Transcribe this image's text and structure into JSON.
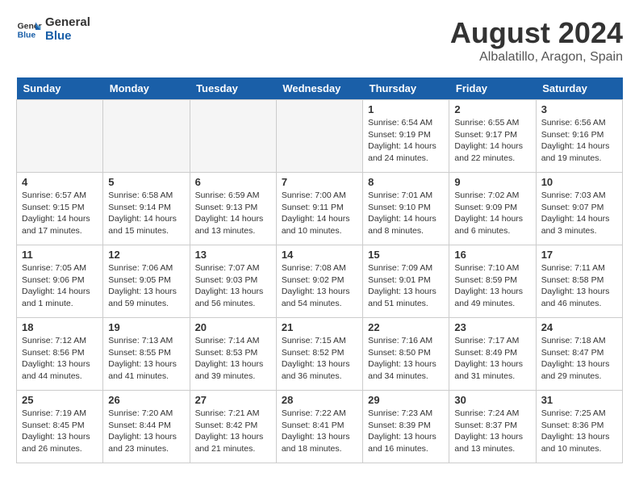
{
  "header": {
    "logo_line1": "General",
    "logo_line2": "Blue",
    "month_year": "August 2024",
    "location": "Albalatillo, Aragon, Spain"
  },
  "days_of_week": [
    "Sunday",
    "Monday",
    "Tuesday",
    "Wednesday",
    "Thursday",
    "Friday",
    "Saturday"
  ],
  "weeks": [
    [
      {
        "day": "",
        "empty": true
      },
      {
        "day": "",
        "empty": true
      },
      {
        "day": "",
        "empty": true
      },
      {
        "day": "",
        "empty": true
      },
      {
        "day": "1",
        "sunrise": "6:54 AM",
        "sunset": "9:19 PM",
        "daylight": "14 hours and 24 minutes."
      },
      {
        "day": "2",
        "sunrise": "6:55 AM",
        "sunset": "9:17 PM",
        "daylight": "14 hours and 22 minutes."
      },
      {
        "day": "3",
        "sunrise": "6:56 AM",
        "sunset": "9:16 PM",
        "daylight": "14 hours and 19 minutes."
      }
    ],
    [
      {
        "day": "4",
        "sunrise": "6:57 AM",
        "sunset": "9:15 PM",
        "daylight": "14 hours and 17 minutes."
      },
      {
        "day": "5",
        "sunrise": "6:58 AM",
        "sunset": "9:14 PM",
        "daylight": "14 hours and 15 minutes."
      },
      {
        "day": "6",
        "sunrise": "6:59 AM",
        "sunset": "9:13 PM",
        "daylight": "14 hours and 13 minutes."
      },
      {
        "day": "7",
        "sunrise": "7:00 AM",
        "sunset": "9:11 PM",
        "daylight": "14 hours and 10 minutes."
      },
      {
        "day": "8",
        "sunrise": "7:01 AM",
        "sunset": "9:10 PM",
        "daylight": "14 hours and 8 minutes."
      },
      {
        "day": "9",
        "sunrise": "7:02 AM",
        "sunset": "9:09 PM",
        "daylight": "14 hours and 6 minutes."
      },
      {
        "day": "10",
        "sunrise": "7:03 AM",
        "sunset": "9:07 PM",
        "daylight": "14 hours and 3 minutes."
      }
    ],
    [
      {
        "day": "11",
        "sunrise": "7:05 AM",
        "sunset": "9:06 PM",
        "daylight": "14 hours and 1 minute."
      },
      {
        "day": "12",
        "sunrise": "7:06 AM",
        "sunset": "9:05 PM",
        "daylight": "13 hours and 59 minutes."
      },
      {
        "day": "13",
        "sunrise": "7:07 AM",
        "sunset": "9:03 PM",
        "daylight": "13 hours and 56 minutes."
      },
      {
        "day": "14",
        "sunrise": "7:08 AM",
        "sunset": "9:02 PM",
        "daylight": "13 hours and 54 minutes."
      },
      {
        "day": "15",
        "sunrise": "7:09 AM",
        "sunset": "9:01 PM",
        "daylight": "13 hours and 51 minutes."
      },
      {
        "day": "16",
        "sunrise": "7:10 AM",
        "sunset": "8:59 PM",
        "daylight": "13 hours and 49 minutes."
      },
      {
        "day": "17",
        "sunrise": "7:11 AM",
        "sunset": "8:58 PM",
        "daylight": "13 hours and 46 minutes."
      }
    ],
    [
      {
        "day": "18",
        "sunrise": "7:12 AM",
        "sunset": "8:56 PM",
        "daylight": "13 hours and 44 minutes."
      },
      {
        "day": "19",
        "sunrise": "7:13 AM",
        "sunset": "8:55 PM",
        "daylight": "13 hours and 41 minutes."
      },
      {
        "day": "20",
        "sunrise": "7:14 AM",
        "sunset": "8:53 PM",
        "daylight": "13 hours and 39 minutes."
      },
      {
        "day": "21",
        "sunrise": "7:15 AM",
        "sunset": "8:52 PM",
        "daylight": "13 hours and 36 minutes."
      },
      {
        "day": "22",
        "sunrise": "7:16 AM",
        "sunset": "8:50 PM",
        "daylight": "13 hours and 34 minutes."
      },
      {
        "day": "23",
        "sunrise": "7:17 AM",
        "sunset": "8:49 PM",
        "daylight": "13 hours and 31 minutes."
      },
      {
        "day": "24",
        "sunrise": "7:18 AM",
        "sunset": "8:47 PM",
        "daylight": "13 hours and 29 minutes."
      }
    ],
    [
      {
        "day": "25",
        "sunrise": "7:19 AM",
        "sunset": "8:45 PM",
        "daylight": "13 hours and 26 minutes."
      },
      {
        "day": "26",
        "sunrise": "7:20 AM",
        "sunset": "8:44 PM",
        "daylight": "13 hours and 23 minutes."
      },
      {
        "day": "27",
        "sunrise": "7:21 AM",
        "sunset": "8:42 PM",
        "daylight": "13 hours and 21 minutes."
      },
      {
        "day": "28",
        "sunrise": "7:22 AM",
        "sunset": "8:41 PM",
        "daylight": "13 hours and 18 minutes."
      },
      {
        "day": "29",
        "sunrise": "7:23 AM",
        "sunset": "8:39 PM",
        "daylight": "13 hours and 16 minutes."
      },
      {
        "day": "30",
        "sunrise": "7:24 AM",
        "sunset": "8:37 PM",
        "daylight": "13 hours and 13 minutes."
      },
      {
        "day": "31",
        "sunrise": "7:25 AM",
        "sunset": "8:36 PM",
        "daylight": "13 hours and 10 minutes."
      }
    ]
  ]
}
